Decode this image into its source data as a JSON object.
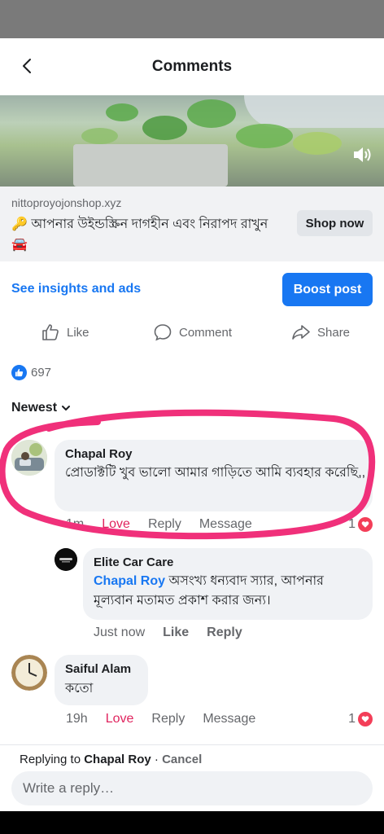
{
  "header": {
    "title": "Comments"
  },
  "ad": {
    "domain": "nittoproyojonshop.xyz",
    "text": "🔑 আপনার উইন্ডস্ক্রিন দাগহীন এবং নিরাপদ রাখুন 🚘",
    "cta": "Shop now"
  },
  "promo": {
    "insights_label": "See insights and ads",
    "boost_label": "Boost post"
  },
  "actions": {
    "like": "Like",
    "comment": "Comment",
    "share": "Share"
  },
  "likes": {
    "count": "697"
  },
  "sort": {
    "label": "Newest"
  },
  "comments": [
    {
      "author": "Chapal Roy",
      "text": "প্রোডাক্টটি খুব ভালো আমার গাড়িতে আমি ব্যবহার করেছি,,",
      "time": "1m",
      "reaction_label": "Love",
      "reply_label": "Reply",
      "message_label": "Message",
      "reaction_count": "1"
    },
    {
      "author": "Elite Car Care",
      "mention": "Chapal Roy",
      "text": "অসংখ্য ধন্যবাদ স্যার, আপনার মূল্যবান মতামত প্রকাশ করার জন্য।",
      "time": "Just now",
      "like_label": "Like",
      "reply_label": "Reply"
    },
    {
      "author": "Saiful Alam",
      "text": "কতো",
      "time": "19h",
      "reaction_label": "Love",
      "reply_label": "Reply",
      "message_label": "Message",
      "reaction_count": "1"
    }
  ],
  "reply_bar": {
    "prefix": "Replying to",
    "name": "Chapal Roy",
    "separator": " · ",
    "cancel": "Cancel",
    "placeholder": "Write a reply…"
  },
  "colors": {
    "accent": "#1877f2",
    "love": "#e0245e",
    "highlight": "#f0307a"
  }
}
